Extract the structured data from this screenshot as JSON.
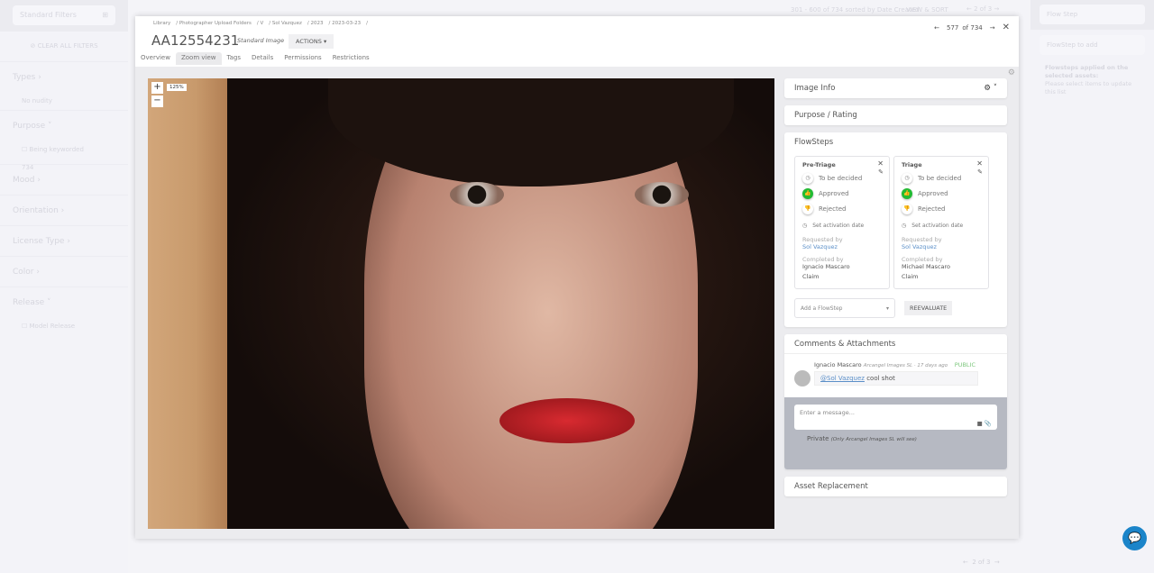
{
  "left_filters": {
    "standard_filters": "Standard Filters",
    "clear_all": "CLEAR ALL FILTERS",
    "types": "Types",
    "no_nudity": "No nudity",
    "purpose": "Purpose",
    "being_keyworded": "Being keyworded",
    "being_keyworded_count": "734",
    "mood": "Mood",
    "orientation": "Orientation",
    "license_type": "License Type",
    "color": "Color",
    "release": "Release",
    "model_release": "Model Release"
  },
  "topbar": {
    "results": "301 - 600 of 734 sorted by Date Created",
    "view_sort": "VIEW & SORT",
    "page": "2",
    "of_pages": "of 3"
  },
  "right_bar": {
    "flow_step": "Flow Step",
    "flowstep_to_add": "FlowStep to add",
    "applied_title": "Flowsteps applied on the selected assets:",
    "applied_hint": "Please select items to update this list"
  },
  "modal": {
    "breadcrumb": [
      "Library",
      "Photographer Upload Folders",
      "V",
      "Sol Vazquez",
      "2023",
      "2023-03-23"
    ],
    "title": "AA12554231",
    "type": "Standard Image",
    "actions": "ACTIONS",
    "position": "577",
    "total": "of 734",
    "tabs": [
      "Overview",
      "Zoom view",
      "Tags",
      "Details",
      "Permissions",
      "Restrictions"
    ],
    "zoom_level": "125%"
  },
  "panel": {
    "image_info": "Image Info",
    "purpose_rating": "Purpose / Rating",
    "flowsteps": "FlowSteps",
    "steps": [
      {
        "name": "Pre-Triage",
        "states": [
          "To be decided",
          "Approved",
          "Rejected"
        ],
        "activation": "Set activation date",
        "requested_label": "Requested by",
        "requested_by": "Sol Vazquez",
        "completed_label": "Completed by",
        "completed_by": "Ignacio Mascaro",
        "claim": "Claim"
      },
      {
        "name": "Triage",
        "states": [
          "To be decided",
          "Approved",
          "Rejected"
        ],
        "activation": "Set activation date",
        "requested_label": "Requested by",
        "requested_by": "Sol Vazquez",
        "completed_label": "Completed by",
        "completed_by": "Michael Mascaro",
        "claim": "Claim"
      }
    ],
    "add_flowstep": "Add a FlowStep",
    "reevaluate": "REEVALUATE",
    "comments_title": "Comments & Attachments",
    "comment": {
      "author": "Ignacio Mascaro",
      "meta": "Arcangel Images SL · 17 days ago",
      "visibility": "PUBLIC",
      "mention": "@Sol Vazquez",
      "text": " cool shot"
    },
    "message_placeholder": "Enter a message...",
    "private": "Private",
    "private_note": "(Only Arcangel Images SL will see)",
    "asset_replacement": "Asset Replacement"
  },
  "bottom": {
    "page": "2",
    "of_pages": "of 3"
  }
}
